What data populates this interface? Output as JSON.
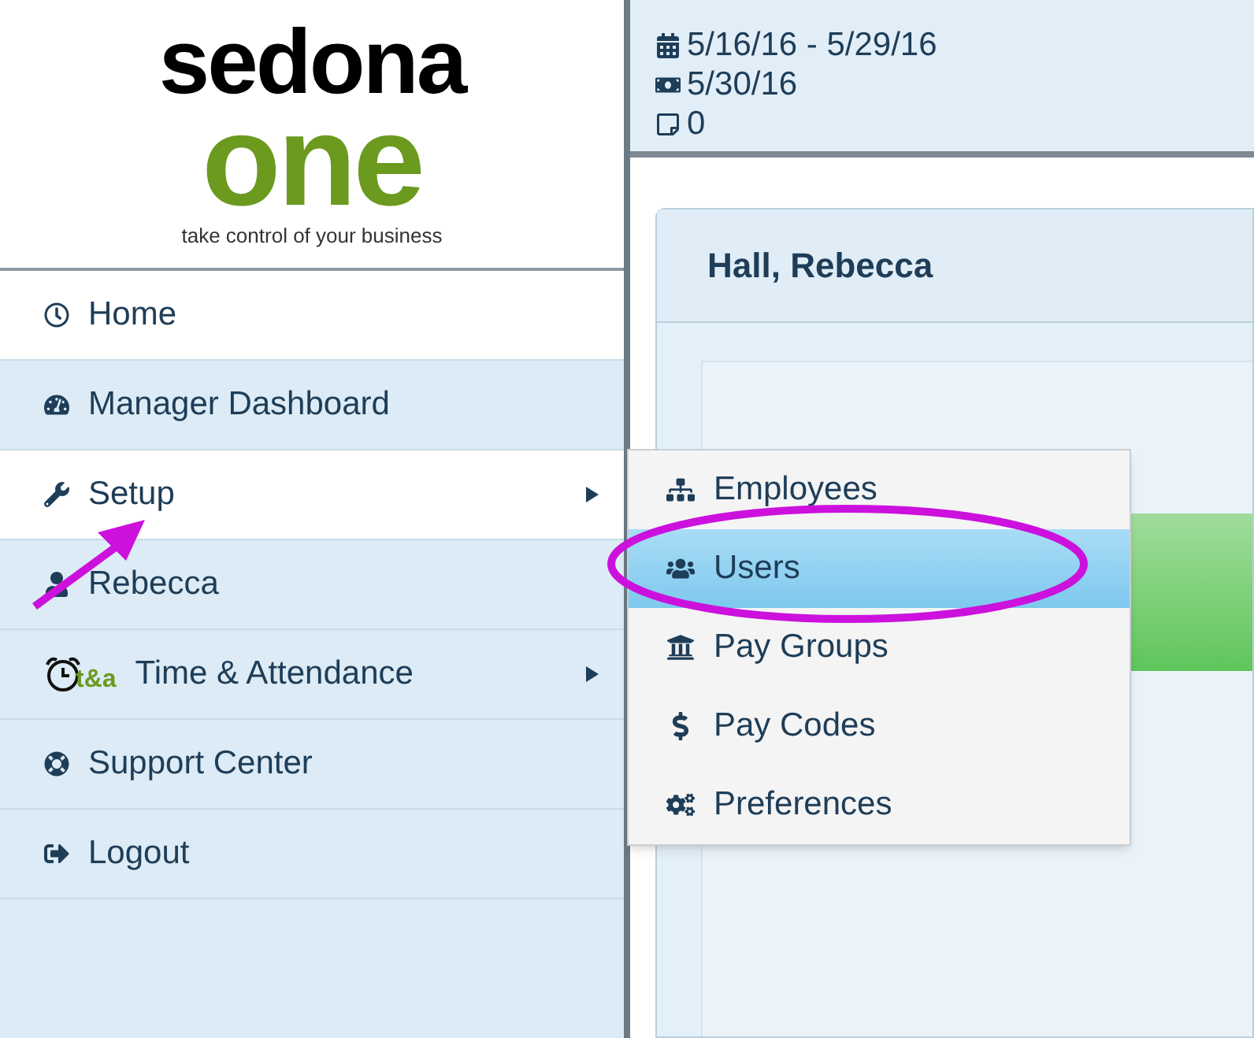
{
  "logo": {
    "word_top": "sedona",
    "word_bottom": "one",
    "tagline": "take control of your business"
  },
  "sidebar": {
    "items": [
      {
        "label": "Home",
        "highlighted": true,
        "submenu": false
      },
      {
        "label": "Manager Dashboard",
        "highlighted": false,
        "submenu": false
      },
      {
        "label": "Setup",
        "highlighted": true,
        "submenu": true
      },
      {
        "label": "Rebecca",
        "highlighted": false,
        "submenu": false
      },
      {
        "label": "Time & Attendance",
        "badge": "t&a",
        "highlighted": false,
        "submenu": true
      },
      {
        "label": "Support Center",
        "highlighted": false,
        "submenu": false
      },
      {
        "label": "Logout",
        "highlighted": false,
        "submenu": false
      }
    ]
  },
  "header": {
    "pay_period": "5/16/16 - 5/29/16",
    "pay_date": "5/30/16",
    "notes": "0"
  },
  "card": {
    "title": "Hall, Rebecca"
  },
  "submenu": {
    "items": [
      {
        "label": "Employees",
        "selected": false
      },
      {
        "label": "Users",
        "selected": true
      },
      {
        "label": "Pay Groups",
        "selected": false
      },
      {
        "label": "Pay Codes",
        "selected": false
      },
      {
        "label": "Preferences",
        "selected": false
      }
    ]
  }
}
